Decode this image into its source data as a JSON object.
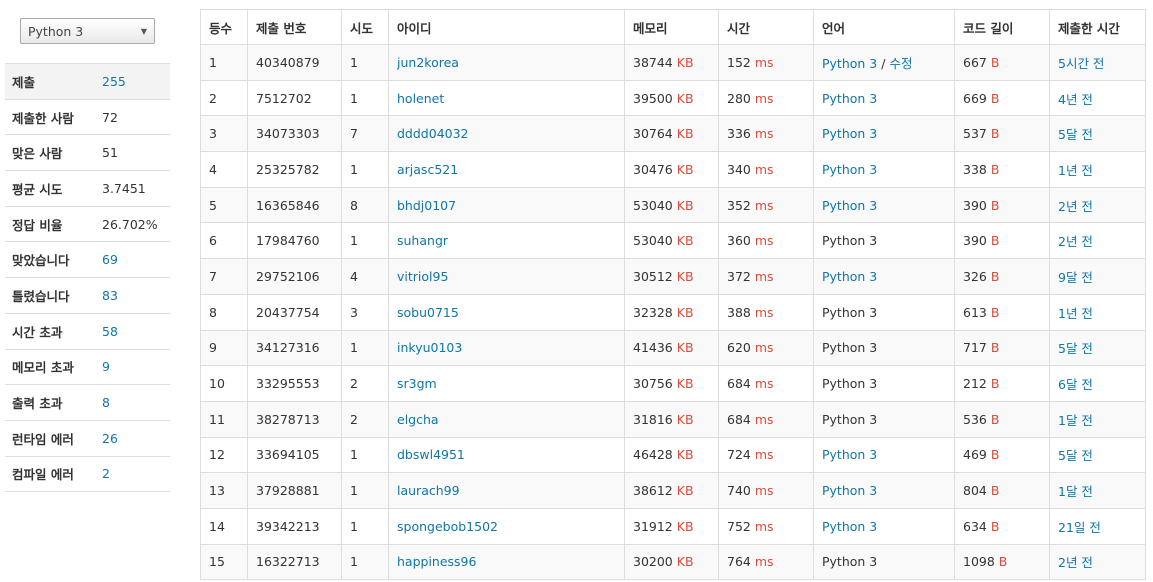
{
  "language_select": {
    "selected": "Python 3"
  },
  "stats": [
    {
      "label": "제출",
      "value": "255",
      "link": true
    },
    {
      "label": "제출한 사람",
      "value": "72",
      "link": false
    },
    {
      "label": "맞은 사람",
      "value": "51",
      "link": false
    },
    {
      "label": "평균 시도",
      "value": "3.7451",
      "link": false
    },
    {
      "label": "정답 비율",
      "value": "26.702%",
      "link": false
    },
    {
      "label": "맞았습니다",
      "value": "69",
      "link": true
    },
    {
      "label": "틀렸습니다",
      "value": "83",
      "link": true
    },
    {
      "label": "시간 초과",
      "value": "58",
      "link": true
    },
    {
      "label": "메모리 초과",
      "value": "9",
      "link": true
    },
    {
      "label": "출력 초과",
      "value": "8",
      "link": true
    },
    {
      "label": "런타임 에러",
      "value": "26",
      "link": true
    },
    {
      "label": "컴파일 에러",
      "value": "2",
      "link": true
    }
  ],
  "table": {
    "headers": [
      "등수",
      "제출 번호",
      "시도",
      "아이디",
      "메모리",
      "시간",
      "언어",
      "코드 길이",
      "제출한 시간"
    ],
    "units": {
      "memory": "KB",
      "time": "ms",
      "code": "B"
    },
    "edit_label": "수정",
    "edit_separator": " / ",
    "rows": [
      {
        "rank": "1",
        "submission": "40340879",
        "tries": "1",
        "user": "jun2korea",
        "memory": "38744",
        "time": "152",
        "lang": "Python 3",
        "lang_link": true,
        "edit": true,
        "code": "667",
        "submitted": "5시간 전"
      },
      {
        "rank": "2",
        "submission": "7512702",
        "tries": "1",
        "user": "holenet",
        "memory": "39500",
        "time": "280",
        "lang": "Python 3",
        "lang_link": true,
        "edit": false,
        "code": "669",
        "submitted": "4년 전"
      },
      {
        "rank": "3",
        "submission": "34073303",
        "tries": "7",
        "user": "dddd04032",
        "memory": "30764",
        "time": "336",
        "lang": "Python 3",
        "lang_link": true,
        "edit": false,
        "code": "537",
        "submitted": "5달 전"
      },
      {
        "rank": "4",
        "submission": "25325782",
        "tries": "1",
        "user": "arjasc521",
        "memory": "30476",
        "time": "340",
        "lang": "Python 3",
        "lang_link": true,
        "edit": false,
        "code": "338",
        "submitted": "1년 전"
      },
      {
        "rank": "5",
        "submission": "16365846",
        "tries": "8",
        "user": "bhdj0107",
        "memory": "53040",
        "time": "352",
        "lang": "Python 3",
        "lang_link": true,
        "edit": false,
        "code": "390",
        "submitted": "2년 전"
      },
      {
        "rank": "6",
        "submission": "17984760",
        "tries": "1",
        "user": "suhangr",
        "memory": "53040",
        "time": "360",
        "lang": "Python 3",
        "lang_link": false,
        "edit": false,
        "code": "390",
        "submitted": "2년 전"
      },
      {
        "rank": "7",
        "submission": "29752106",
        "tries": "4",
        "user": "vitriol95",
        "memory": "30512",
        "time": "372",
        "lang": "Python 3",
        "lang_link": true,
        "edit": false,
        "code": "326",
        "submitted": "9달 전"
      },
      {
        "rank": "8",
        "submission": "20437754",
        "tries": "3",
        "user": "sobu0715",
        "memory": "32328",
        "time": "388",
        "lang": "Python 3",
        "lang_link": false,
        "edit": false,
        "code": "613",
        "submitted": "1년 전"
      },
      {
        "rank": "9",
        "submission": "34127316",
        "tries": "1",
        "user": "inkyu0103",
        "memory": "41436",
        "time": "620",
        "lang": "Python 3",
        "lang_link": false,
        "edit": false,
        "code": "717",
        "submitted": "5달 전"
      },
      {
        "rank": "10",
        "submission": "33295553",
        "tries": "2",
        "user": "sr3gm",
        "memory": "30756",
        "time": "684",
        "lang": "Python 3",
        "lang_link": false,
        "edit": false,
        "code": "212",
        "submitted": "6달 전"
      },
      {
        "rank": "11",
        "submission": "38278713",
        "tries": "2",
        "user": "elgcha",
        "memory": "31816",
        "time": "684",
        "lang": "Python 3",
        "lang_link": false,
        "edit": false,
        "code": "536",
        "submitted": "1달 전"
      },
      {
        "rank": "12",
        "submission": "33694105",
        "tries": "1",
        "user": "dbswl4951",
        "memory": "46428",
        "time": "724",
        "lang": "Python 3",
        "lang_link": true,
        "edit": false,
        "code": "469",
        "submitted": "5달 전"
      },
      {
        "rank": "13",
        "submission": "37928881",
        "tries": "1",
        "user": "laurach99",
        "memory": "38612",
        "time": "740",
        "lang": "Python 3",
        "lang_link": true,
        "edit": false,
        "code": "804",
        "submitted": "1달 전"
      },
      {
        "rank": "14",
        "submission": "39342213",
        "tries": "1",
        "user": "spongebob1502",
        "memory": "31912",
        "time": "752",
        "lang": "Python 3",
        "lang_link": true,
        "edit": false,
        "code": "634",
        "submitted": "21일 전"
      },
      {
        "rank": "15",
        "submission": "16322713",
        "tries": "1",
        "user": "happiness96",
        "memory": "30200",
        "time": "764",
        "lang": "Python 3",
        "lang_link": false,
        "edit": false,
        "code": "1098",
        "submitted": "2년 전"
      }
    ]
  }
}
